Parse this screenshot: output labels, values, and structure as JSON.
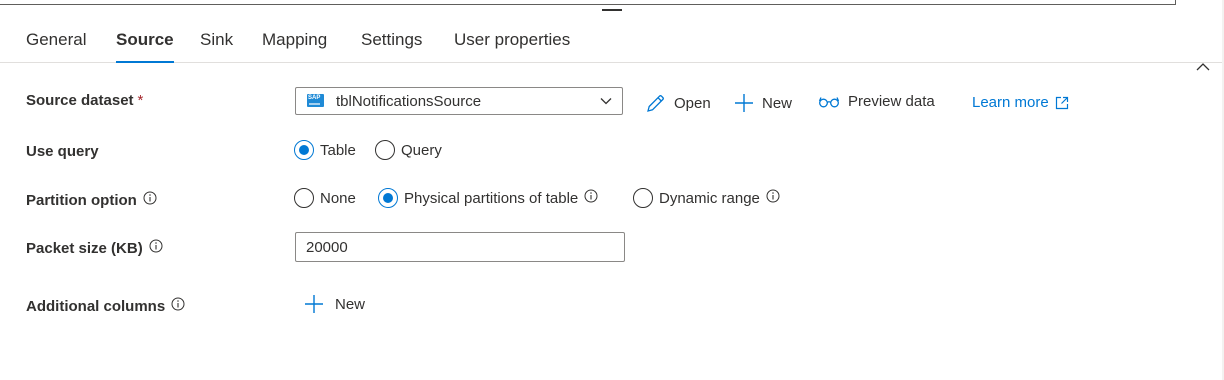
{
  "tabs": [
    {
      "label": "General",
      "active": false
    },
    {
      "label": "Source",
      "active": true
    },
    {
      "label": "Sink",
      "active": false
    },
    {
      "label": "Mapping",
      "active": false
    },
    {
      "label": "Settings",
      "active": false
    },
    {
      "label": "User properties",
      "active": false
    }
  ],
  "source_dataset": {
    "label": "Source dataset",
    "required_mark": "*",
    "value": "tblNotificationsSource",
    "icon": "sap-dataset-icon",
    "icon_text": "SAP",
    "actions": {
      "open": "Open",
      "new": "New",
      "preview": "Preview data"
    },
    "learn_more": "Learn more"
  },
  "use_query": {
    "label": "Use query",
    "options": [
      "Table",
      "Query"
    ],
    "selected": "Table"
  },
  "partition_option": {
    "label": "Partition option",
    "options": [
      "None",
      "Physical partitions of table",
      "Dynamic range"
    ],
    "selected": "Physical partitions of table"
  },
  "packet_size": {
    "label": "Packet size (KB)",
    "value": "20000"
  },
  "additional_columns": {
    "label": "Additional columns",
    "new": "New"
  },
  "colors": {
    "accent": "#0078d4",
    "text": "#323130",
    "required": "#a4262c",
    "border": "#8a8886"
  }
}
